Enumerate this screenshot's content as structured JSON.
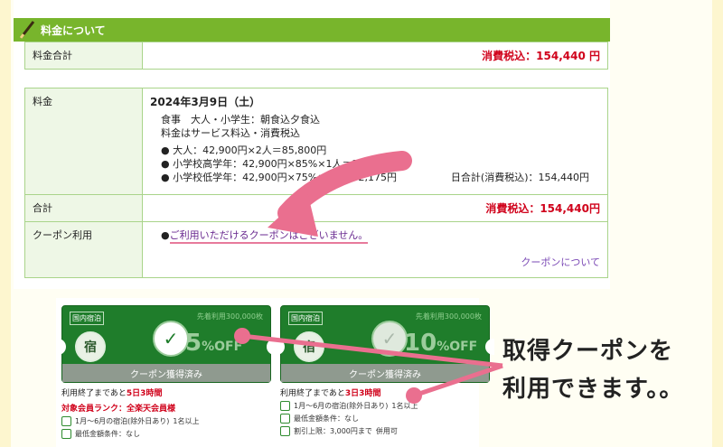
{
  "header": {
    "title": "料金について",
    "icon": "pen-icon"
  },
  "totals_table": {
    "label": "料金合計",
    "value": "消費税込：154,440 円"
  },
  "fee_table": {
    "label": "料金",
    "date": "2024年3月9日（土）",
    "plan_line1": "食事　大人・小学生：朝食込夕食込",
    "plan_line2": "料金はサービス料込・消費税込",
    "items": [
      "● 大人：42,900円×2人＝85,800円",
      "● 小学校高学年：42,900円×85%×1人＝36,465円",
      "● 小学校低学年：42,900円×75%×1人＝32,175円"
    ],
    "day_total": "日合計(消費税込)：154,440円",
    "sum_label": "合計",
    "sum_value": "消費税込：154,440円",
    "coupon_label": "クーポン利用",
    "coupon_bullet": "●",
    "coupon_text": "ご利用いただけるクーポンはございません。",
    "coupon_link": "クーポンについて"
  },
  "coupons": [
    {
      "tag": "国内宿泊",
      "used": "先着利用300,000枚",
      "seal": "宿",
      "percent": "5",
      "off": "%OFF",
      "band": "クーポン獲得済み",
      "deadline_prefix": "利用終了まであと",
      "deadline_value": "5日3時間",
      "rank": "対象会員ランク：全楽天会員様",
      "line1": "1月〜6月の宿泊(除外日あり)",
      "people1": "1名以上",
      "line2": "最低金額条件：なし"
    },
    {
      "tag": "国内宿泊",
      "used": "先着利用300,000枚",
      "seal": "宿",
      "percent": "10",
      "off": "%OFF",
      "band": "クーポン獲得済み",
      "deadline_prefix": "利用終了まであと",
      "deadline_value": "3日3時間",
      "line1": "1月〜6月の宿泊(除外日あり)",
      "people1": "1名以上",
      "line2": "最低金額条件：なし",
      "line3": "割引上限：3,000円まで",
      "line3b": "併用可"
    }
  ],
  "callout": {
    "line1": "取得クーポンを",
    "line2": "利用できます。。"
  },
  "colors": {
    "green": "#78b52c",
    "red": "#d0021b",
    "pink": "#ea6f8f",
    "purple": "#7a48b5"
  }
}
